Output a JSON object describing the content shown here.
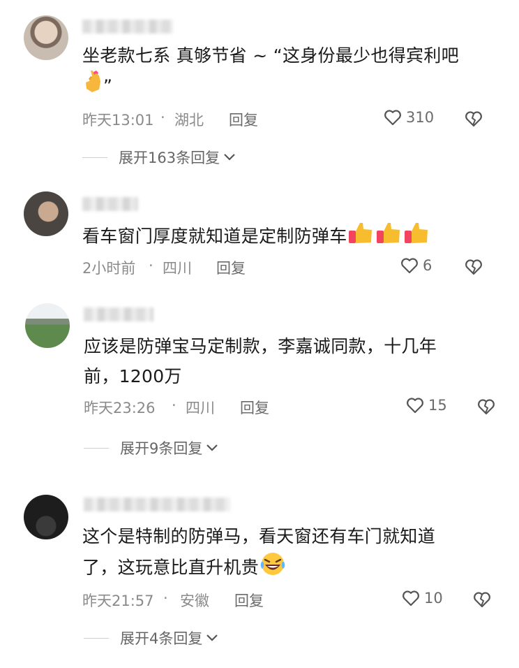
{
  "comments": [
    {
      "text": "坐老款七系 真够节省 ~ “这身份最少也得宾利吧",
      "text2": "”",
      "time": "昨天13:01",
      "dot": "·",
      "location": "湖北",
      "reply": "回复",
      "likes": "310",
      "expand": "展开163条回复"
    },
    {
      "text": "看车窗门厚度就知道是定制防弹车",
      "time": "2小时前",
      "dot": "·",
      "location": "四川",
      "reply": "回复",
      "likes": "6"
    },
    {
      "text": "应该是防弹宝马定制款，李嘉诚同款，十几年",
      "text2": "前，1200万",
      "time": "昨天23:26",
      "dot": "·",
      "location": "四川",
      "reply": "回复",
      "likes": "15",
      "expand": "展开9条回复"
    },
    {
      "text": "这个是特制的防弹马，看天窗还有车门就知道",
      "text2": "了，这玩意比直升机贵",
      "time": "昨天21:57",
      "dot": "·",
      "location": "安徽",
      "reply": "回复",
      "likes": "10",
      "expand": "展开4条回复"
    }
  ]
}
